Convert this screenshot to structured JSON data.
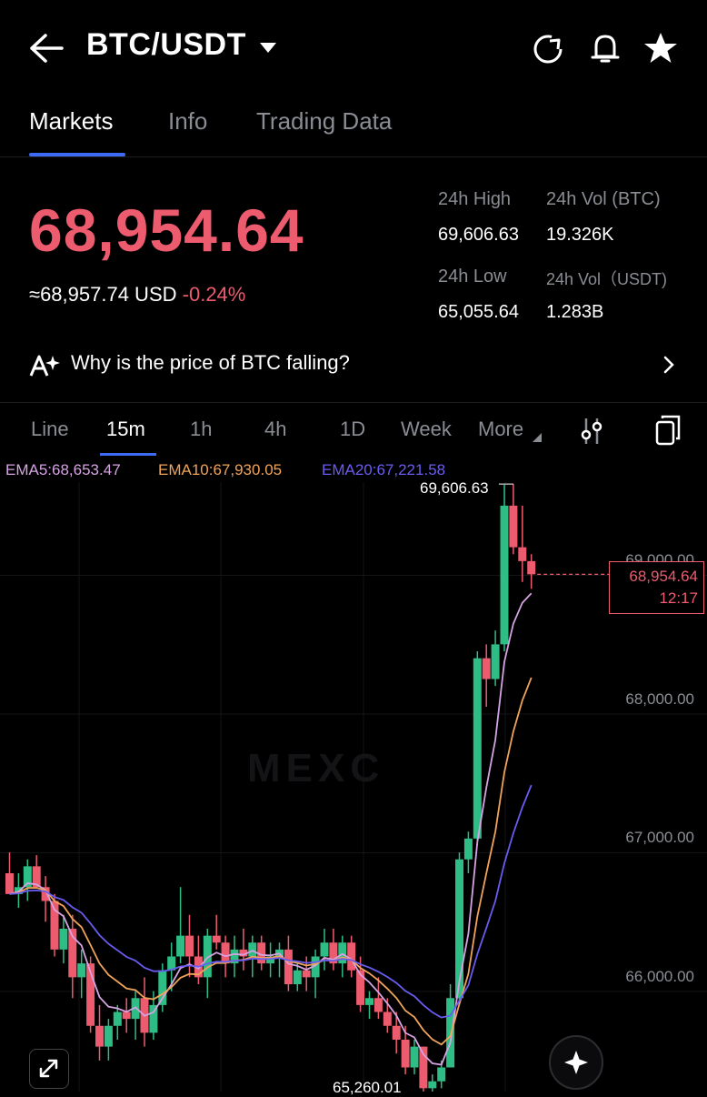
{
  "header": {
    "pair": "BTC/USDT",
    "icons": [
      "back-arrow-icon",
      "caret-down-icon",
      "refresh-icon",
      "bell-icon",
      "star-icon"
    ]
  },
  "tabs": [
    {
      "label": "Markets",
      "active": true
    },
    {
      "label": "Info",
      "active": false
    },
    {
      "label": "Trading Data",
      "active": false
    }
  ],
  "ticker": {
    "last_price": "68,954.64",
    "fiat_value": "≈68,957.74 USD",
    "change": "-0.24%",
    "high_label": "24h High",
    "high_value": "69,606.63",
    "vol_btc_label": "24h Vol (BTC)",
    "vol_btc_value": "19.326K",
    "low_label": "24h Low",
    "low_value": "65,055.64",
    "vol_usdt_label": "24h Vol（USDT)",
    "vol_usdt_value": "1.283B",
    "up_color": "#2ebd85",
    "down_color": "#ec5b6e"
  },
  "insight": {
    "text": "Why is the price of BTC falling?",
    "icon": "ai-sparkle-icon"
  },
  "intervals": [
    {
      "label": "Line",
      "active": false
    },
    {
      "label": "15m",
      "active": true
    },
    {
      "label": "1h",
      "active": false
    },
    {
      "label": "4h",
      "active": false
    },
    {
      "label": "1D",
      "active": false
    },
    {
      "label": "Week",
      "active": false
    },
    {
      "label": "More",
      "active": false
    }
  ],
  "toolbar_icons": [
    "indicator-settings-icon",
    "copy-layout-icon"
  ],
  "ema": {
    "ema5": "EMA5:68,653.47",
    "ema10": "EMA10:67,930.05",
    "ema20": "EMA20:67,221.58",
    "ema5_color": "#d6a3e3",
    "ema10_color": "#f0a35a",
    "ema20_color": "#6a5cf0"
  },
  "chart": {
    "watermark": "MEXC",
    "axis_labels": [
      "69,000.00",
      "68,000.00",
      "67,000.00",
      "66,000.00"
    ],
    "current_price": "68,954.64",
    "countdown": "12:17",
    "high_marker": "69,606.63",
    "low_marker": "65,260.01"
  },
  "chart_data": {
    "type": "candlestick",
    "interval": "15m",
    "ylim": [
      65000,
      69650
    ],
    "y_ticks": [
      66000,
      67000,
      68000,
      69000
    ],
    "candles": [
      [
        66800,
        66950,
        66700,
        66650
      ],
      [
        66650,
        66800,
        66550,
        66700
      ],
      [
        66700,
        66900,
        66600,
        66850
      ],
      [
        66850,
        66930,
        66700,
        66700
      ],
      [
        66700,
        66780,
        66450,
        66600
      ],
      [
        66600,
        66650,
        66200,
        66250
      ],
      [
        66250,
        66500,
        66150,
        66400
      ],
      [
        66400,
        66500,
        65900,
        66050
      ],
      [
        66050,
        66250,
        65900,
        66150
      ],
      [
        66150,
        66200,
        65650,
        65700
      ],
      [
        65700,
        65850,
        65450,
        65550
      ],
      [
        65550,
        65750,
        65450,
        65700
      ],
      [
        65700,
        65850,
        65600,
        65800
      ],
      [
        65800,
        65900,
        65650,
        65750
      ],
      [
        65750,
        65950,
        65600,
        65900
      ],
      [
        65900,
        66050,
        65550,
        65650
      ],
      [
        65650,
        65950,
        65600,
        65850
      ],
      [
        65850,
        66150,
        65800,
        66100
      ],
      [
        66100,
        66300,
        65950,
        66200
      ],
      [
        66200,
        66700,
        66150,
        66350
      ],
      [
        66350,
        66500,
        66050,
        66200
      ],
      [
        66200,
        66350,
        66000,
        66050
      ],
      [
        66050,
        66400,
        65900,
        66350
      ],
      [
        66350,
        66500,
        66250,
        66300
      ],
      [
        66300,
        66350,
        66050,
        66150
      ],
      [
        66150,
        66350,
        66050,
        66250
      ],
      [
        66250,
        66400,
        66100,
        66200
      ],
      [
        66200,
        66350,
        66050,
        66300
      ],
      [
        66300,
        66350,
        66100,
        66150
      ],
      [
        66150,
        66300,
        66050,
        66200
      ],
      [
        66200,
        66300,
        66050,
        66250
      ],
      [
        66250,
        66350,
        65950,
        66000
      ],
      [
        66000,
        66150,
        65950,
        66100
      ],
      [
        66100,
        66200,
        65950,
        66050
      ],
      [
        66050,
        66250,
        65900,
        66200
      ],
      [
        66200,
        66400,
        66100,
        66300
      ],
      [
        66300,
        66400,
        66100,
        66150
      ],
      [
        66150,
        66350,
        66050,
        66300
      ],
      [
        66300,
        66350,
        66050,
        66100
      ],
      [
        66100,
        66200,
        65800,
        65850
      ],
      [
        65850,
        65950,
        65750,
        65900
      ],
      [
        65900,
        66050,
        65750,
        65800
      ],
      [
        65800,
        65900,
        65650,
        65700
      ],
      [
        65700,
        65800,
        65500,
        65600
      ],
      [
        65600,
        65700,
        65350,
        65400
      ],
      [
        65400,
        65600,
        65350,
        65550
      ],
      [
        65550,
        65550,
        65150,
        65250
      ],
      [
        65250,
        65350,
        65150,
        65300
      ],
      [
        65300,
        65450,
        65250,
        65400
      ],
      [
        65400,
        66000,
        65400,
        65900
      ],
      [
        65900,
        66950,
        65850,
        66900
      ],
      [
        66900,
        67100,
        66800,
        67050
      ],
      [
        67050,
        68400,
        67000,
        68350
      ],
      [
        68350,
        68450,
        68000,
        68200
      ],
      [
        68200,
        68550,
        68150,
        68450
      ],
      [
        68450,
        69600,
        68400,
        69450
      ],
      [
        69450,
        69606,
        69100,
        69150
      ],
      [
        69150,
        69450,
        68900,
        69050
      ],
      [
        69050,
        69100,
        68850,
        68955
      ]
    ]
  }
}
